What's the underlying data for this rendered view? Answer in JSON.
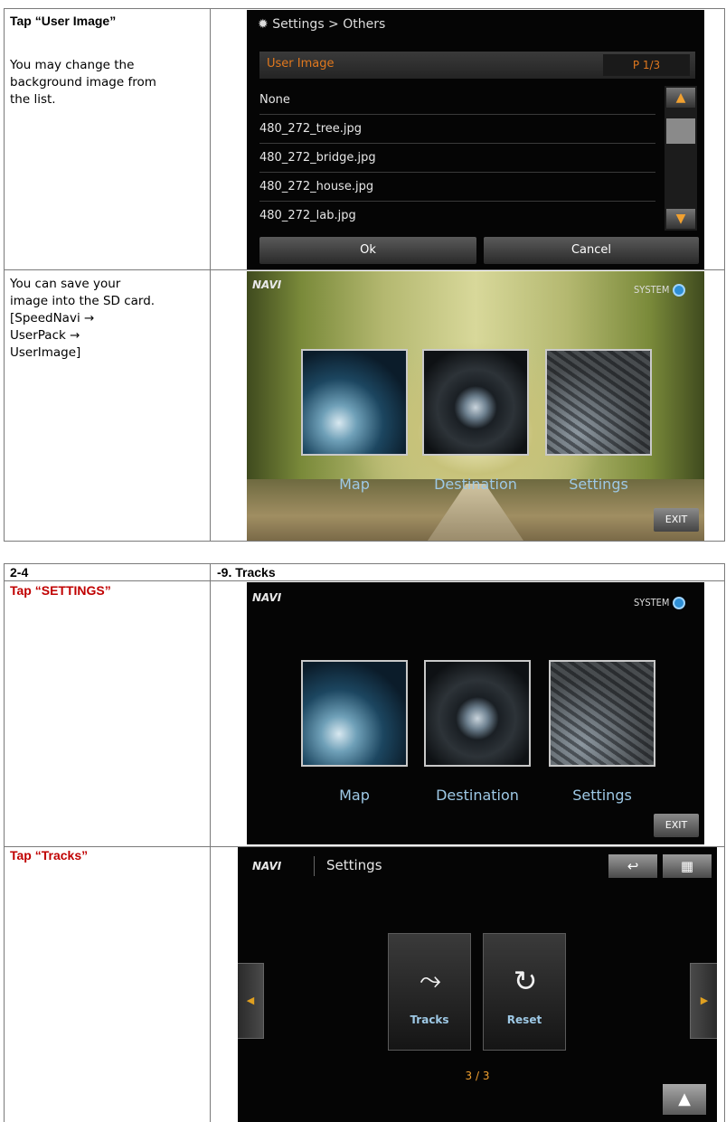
{
  "section1": {
    "row1": {
      "heading": "Tap “User Image”",
      "note": [
        "You may change the",
        "background image from",
        "the list."
      ],
      "screen": {
        "breadcrumb": "Settings > Others",
        "header_label": "User Image",
        "page_indicator": "P 1/3",
        "items": [
          "None",
          "480_272_tree.jpg",
          "480_272_bridge.jpg",
          "480_272_house.jpg",
          "480_272_lab.jpg"
        ],
        "ok_label": "Ok",
        "cancel_label": "Cancel"
      }
    },
    "row2": {
      "note": [
        "You can save your",
        "image into the SD card.",
        "[SpeedNavi →",
        "UserPack →",
        "UserImage]"
      ],
      "screen": {
        "system_label": "SYSTEM",
        "map_label": "Map",
        "destination_label": "Destination",
        "settings_label": "Settings",
        "exit_label": "EXIT"
      }
    }
  },
  "section2": {
    "header_left": "2-4",
    "header_right": "-9. Tracks",
    "row1": {
      "heading": "Tap “SETTINGS”",
      "screen": {
        "system_label": "SYSTEM",
        "map_label": "Map",
        "destination_label": "Destination",
        "settings_label": "Settings",
        "exit_label": "EXIT"
      }
    },
    "row2": {
      "heading": "Tap “Tracks”",
      "screen": {
        "title": "Settings",
        "tracks_label": "Tracks",
        "reset_label": "Reset",
        "page_indicator": "3 / 3"
      }
    }
  },
  "colors": {
    "accent_red": "#c00000",
    "dialog_orange": "#e0781e",
    "label_blue": "#9ec9e6"
  }
}
